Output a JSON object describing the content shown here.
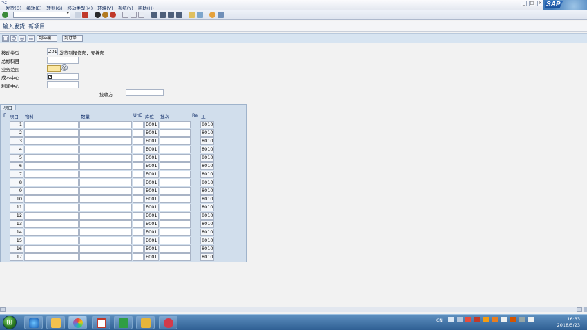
{
  "menu": {
    "items": [
      "发货(O)",
      "编辑(E)",
      "转到(G)",
      "移动类型(M)",
      "环境(V)",
      "系统(Y)",
      "帮助(H)"
    ],
    "logo_text": "SAP"
  },
  "window": {
    "title": "输入发货: 新项目"
  },
  "app_toolbar": {
    "btn_adopt": "到种编...",
    "btn_order": "到订单..."
  },
  "header": {
    "movement_type_label": "移动类型",
    "movement_type_code": "Z01",
    "movement_type_text": "发货到操作部，安拆部",
    "gl_account_label": "总帐科目",
    "gl_account_value": "",
    "business_area_label": "业务范围",
    "business_area_value": "",
    "cost_center_label": "成本中心",
    "cost_center_value": "",
    "profit_center_label": "利润中心",
    "profit_center_value": "",
    "recipient_label": "接收方",
    "recipient_value": ""
  },
  "items": {
    "section_title": "项目",
    "columns": {
      "flag": "F",
      "item": "项目",
      "material": "物料",
      "quantity": "数量",
      "unit": "UnE",
      "storage_location": "库位",
      "batch": "批次",
      "re": "Re",
      "plant": "工厂"
    },
    "rows": [
      {
        "item": "1",
        "storage_location": "E001",
        "plant": "8010"
      },
      {
        "item": "2",
        "storage_location": "E001",
        "plant": "8010"
      },
      {
        "item": "3",
        "storage_location": "E001",
        "plant": "8010"
      },
      {
        "item": "4",
        "storage_location": "E001",
        "plant": "8010"
      },
      {
        "item": "5",
        "storage_location": "E001",
        "plant": "8010"
      },
      {
        "item": "6",
        "storage_location": "E001",
        "plant": "8010"
      },
      {
        "item": "7",
        "storage_location": "E001",
        "plant": "8010"
      },
      {
        "item": "8",
        "storage_location": "E001",
        "plant": "8010"
      },
      {
        "item": "9",
        "storage_location": "E001",
        "plant": "8010"
      },
      {
        "item": "10",
        "storage_location": "E001",
        "plant": "8010"
      },
      {
        "item": "11",
        "storage_location": "E001",
        "plant": "8010"
      },
      {
        "item": "12",
        "storage_location": "E001",
        "plant": "8010"
      },
      {
        "item": "13",
        "storage_location": "E001",
        "plant": "8010"
      },
      {
        "item": "14",
        "storage_location": "E001",
        "plant": "8010"
      },
      {
        "item": "15",
        "storage_location": "E001",
        "plant": "8010"
      },
      {
        "item": "16",
        "storage_location": "E001",
        "plant": "8010"
      },
      {
        "item": "17",
        "storage_location": "E001",
        "plant": "8010"
      }
    ]
  },
  "taskbar": {
    "tray_lang": "CN",
    "time": "16:33",
    "date": "2018/5/23"
  },
  "colors": {
    "panel_bg": "#d1deec",
    "required_field": "#fbe7a3",
    "header_text": "#0d2b68"
  }
}
